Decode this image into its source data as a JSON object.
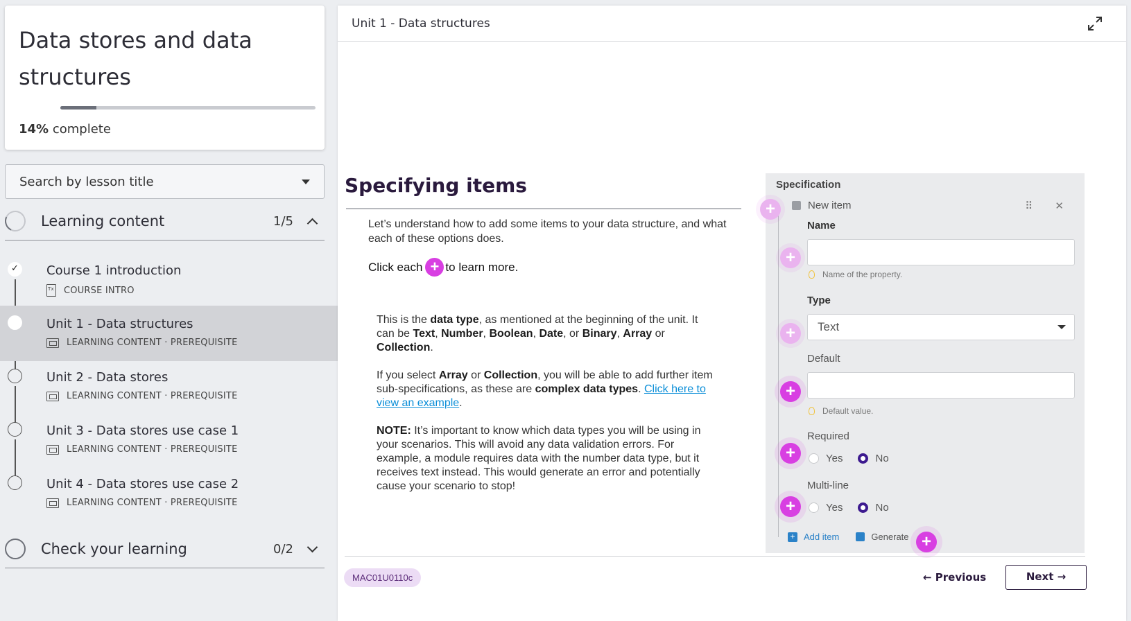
{
  "course": {
    "title": "Data stores and data structures",
    "progress_percent": 14,
    "progress_value": "14%",
    "progress_suffix": "complete"
  },
  "search": {
    "label": "Search by lesson title"
  },
  "sections": [
    {
      "title": "Learning content",
      "count": "1/5",
      "expanded": true
    },
    {
      "title": "Check your learning",
      "count": "0/2",
      "expanded": false
    }
  ],
  "lessons": [
    {
      "title": "Course 1 introduction",
      "meta": "COURSE INTRO",
      "status": "done",
      "icon": "document-icon"
    },
    {
      "title": "Unit 1 - Data structures",
      "meta": "LEARNING CONTENT · PREREQUISITE",
      "status": "current",
      "icon": "slides-icon"
    },
    {
      "title": "Unit 2 - Data stores",
      "meta": "LEARNING CONTENT · PREREQUISITE",
      "status": "todo",
      "icon": "slides-icon"
    },
    {
      "title": "Unit 3 - Data stores use case 1",
      "meta": "LEARNING CONTENT · PREREQUISITE",
      "status": "todo",
      "icon": "slides-icon"
    },
    {
      "title": "Unit 4 - Data stores use case 2",
      "meta": "LEARNING CONTENT · PREREQUISITE",
      "status": "todo",
      "icon": "slides-icon"
    }
  ],
  "main": {
    "title": "Unit 1 - Data structures",
    "heading": "Specifying items",
    "intro": "Let’s understand how to add some items to your data structure, and what each of these options does.",
    "click_prefix": "Click each",
    "click_suffix": "to learn more.",
    "p1": {
      "a": "This is the ",
      "b": "data type",
      "c": ", as mentioned at the beginning of the unit. It can be ",
      "t1": "Text",
      "s1": ", ",
      "t2": "Number",
      "s2": ", ",
      "t3": "Boolean",
      "s3": ", ",
      "t4": "Date",
      "s4": ", or ",
      "t5": "Binary",
      "s5": ", ",
      "t6": "Array",
      "s6": " or ",
      "t7": "Collection",
      "s7": "."
    },
    "p2": {
      "a": "If you select ",
      "b": "Array",
      "c": " or ",
      "d": "Collection",
      "e": ", you will be able to add further item sub-specifications, as these are ",
      "f": "complex data types",
      "g": ". ",
      "link": "Click here to view an example",
      "h": "."
    },
    "p3": {
      "label": "NOTE:",
      "text": " It’s important to know which data types you will be using in your scenarios. This will avoid any data validation errors. For example, a module requires data with the number data type, but it receives text instead. This would generate an error and potentially cause your scenario to stop!"
    },
    "code": "MAC01U0110c",
    "prev_label": "← Previous",
    "next_label": "Next →"
  },
  "spec": {
    "title": "Specification",
    "new_item": "New item",
    "tools": "⠿ ✕",
    "name_label": "Name",
    "name_hint": "Name of the property.",
    "type_label": "Type",
    "type_value": "Text",
    "default_label": "Default",
    "default_hint": "Default value.",
    "required_label": "Required",
    "multiline_label": "Multi-line",
    "yes": "Yes",
    "no": "No",
    "required_value": "No",
    "multiline_value": "No",
    "add_item": "Add item",
    "generate": "Generate"
  },
  "colors": {
    "accent": "#d83fe2",
    "brand_dark": "#2a1a3d",
    "link": "#0a8ed8"
  }
}
